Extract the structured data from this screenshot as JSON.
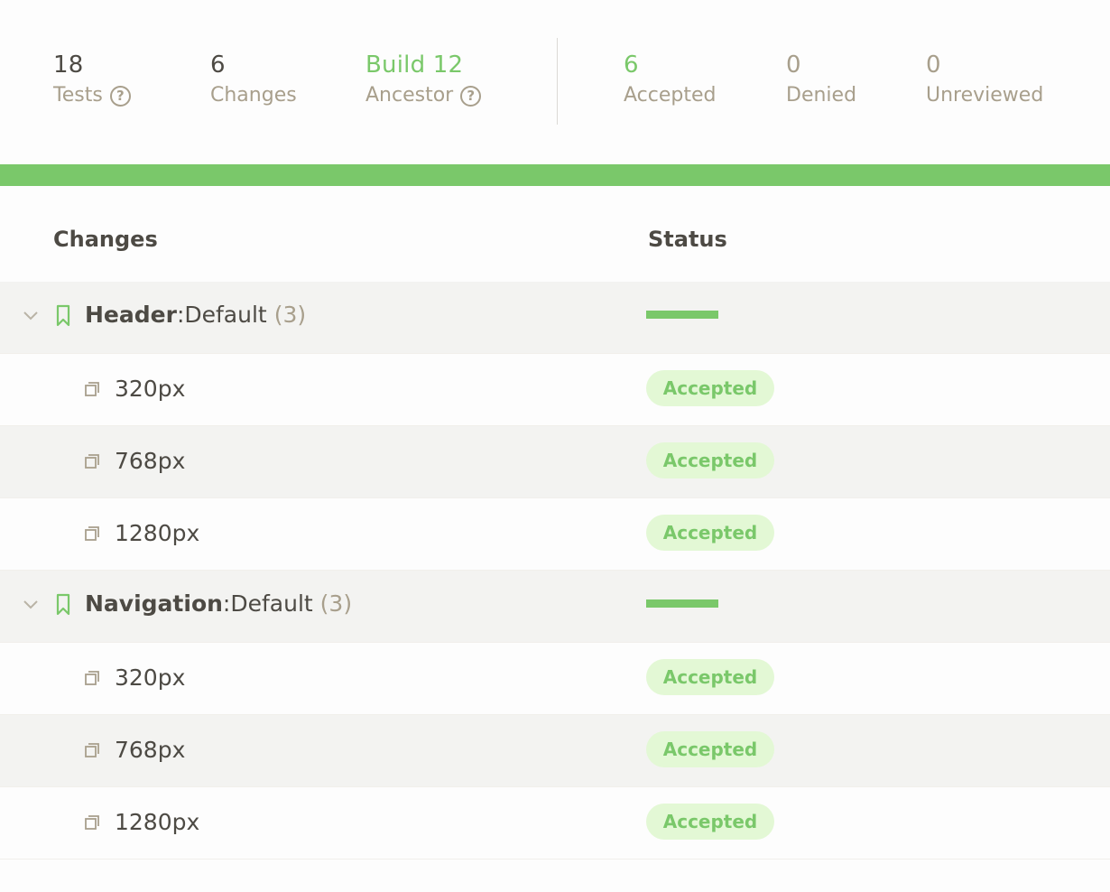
{
  "stats": {
    "tests": {
      "value": "18",
      "label": "Tests"
    },
    "changes": {
      "value": "6",
      "label": "Changes"
    },
    "ancestor": {
      "value": "Build 12",
      "label": "Ancestor"
    },
    "accepted": {
      "value": "6",
      "label": "Accepted"
    },
    "denied": {
      "value": "0",
      "label": "Denied"
    },
    "unreviewed": {
      "value": "0",
      "label": "Unreviewed"
    }
  },
  "progress": {
    "accepted_fraction": 1.0,
    "color": "#7ac86a"
  },
  "columns": {
    "changes": "Changes",
    "status": "Status"
  },
  "groups": [
    {
      "name": "Header",
      "separator": ":",
      "variant": "Default",
      "count": "(3)",
      "items": [
        {
          "label": "320px",
          "status": "Accepted"
        },
        {
          "label": "768px",
          "status": "Accepted"
        },
        {
          "label": "1280px",
          "status": "Accepted"
        }
      ]
    },
    {
      "name": "Navigation",
      "separator": ":",
      "variant": "Default",
      "count": "(3)",
      "items": [
        {
          "label": "320px",
          "status": "Accepted"
        },
        {
          "label": "768px",
          "status": "Accepted"
        },
        {
          "label": "1280px",
          "status": "Accepted"
        }
      ]
    }
  ],
  "colors": {
    "accent_green": "#7ac86a",
    "badge_bg": "#e3f8d5",
    "muted_tan": "#a89f8c",
    "text_dark": "#4d4a44"
  }
}
